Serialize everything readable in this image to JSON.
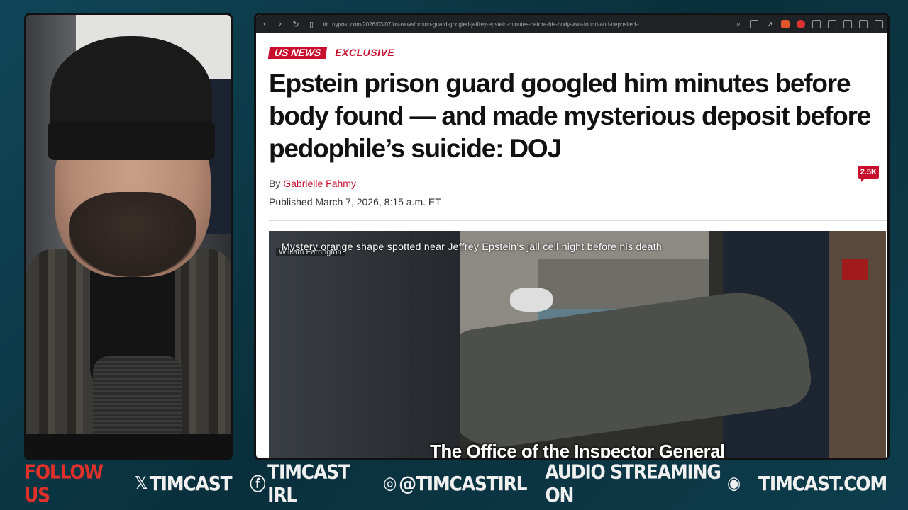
{
  "browser": {
    "url": "nypost.com/2026/03/07/us-news/prison-guard-googled-jeffrey-epstein-minutes-before-his-body-was-found-and-deposited-t..."
  },
  "article": {
    "section_tag": "US NEWS",
    "exclusive_tag": "EXCLUSIVE",
    "headline": "Epstein prison guard googled him minutes before body found — and made mysterious deposit before pedophile’s suicide: DOJ",
    "byline_prefix": "By",
    "author": "Gabrielle Fahmy",
    "published": "Published March 7, 2026, 8:15 a.m. ET",
    "comment_count": "2.5K",
    "photo_caption": "Mystery orange shape spotted near Jeffrey Epstein’s jail cell night before his death",
    "photo_credit": "William Farrington",
    "video_subtitle": "The Office of the Inspector General"
  },
  "footer": {
    "follow": "FOLLOW US",
    "x_handle": "TIMCAST",
    "facebook_handle": "TIMCAST IRL",
    "instagram_handle": "@TIMCASTIRL",
    "audio": "AUDIO STREAMING ON",
    "site": "TIMCAST.COM"
  },
  "colors": {
    "brand_red": "#c8102e",
    "follow_red": "#e0302a",
    "background": "#0d3a4a"
  }
}
